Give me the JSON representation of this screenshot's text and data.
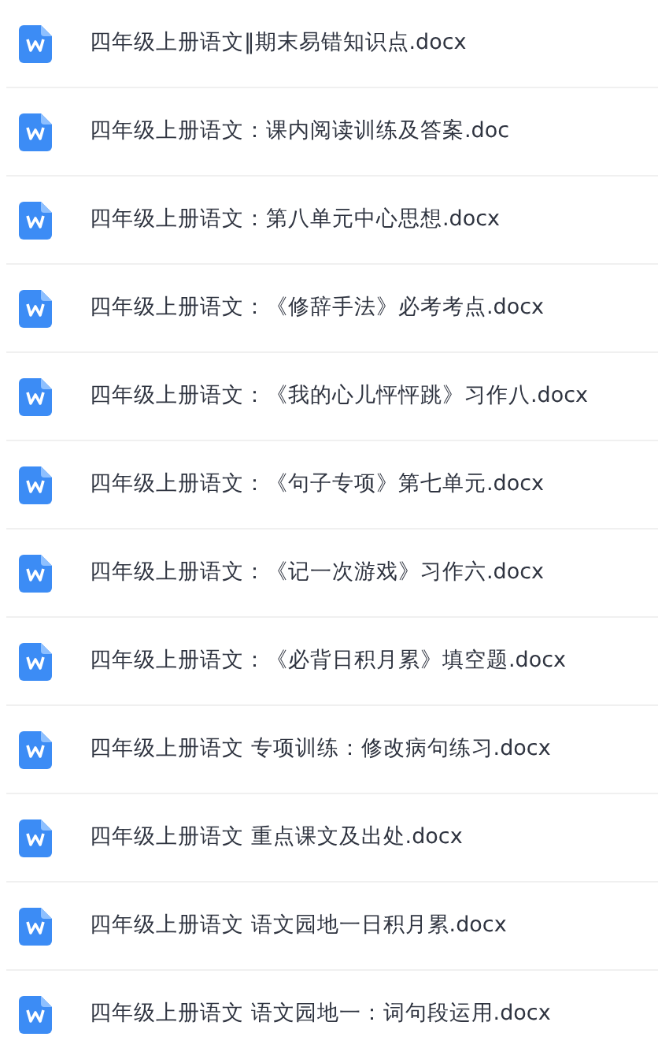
{
  "files": [
    {
      "name": "四年级上册语文‖期末易错知识点.docx"
    },
    {
      "name": "四年级上册语文：课内阅读训练及答案.doc"
    },
    {
      "name": "四年级上册语文：第八单元中心思想.docx"
    },
    {
      "name": "四年级上册语文：《修辞手法》必考考点.docx"
    },
    {
      "name": "四年级上册语文：《我的心儿怦怦跳》习作八.docx"
    },
    {
      "name": "四年级上册语文：《句子专项》第七单元.docx"
    },
    {
      "name": "四年级上册语文：《记一次游戏》习作六.docx"
    },
    {
      "name": "四年级上册语文：《必背日积月累》填空题.docx"
    },
    {
      "name": "四年级上册语文 专项训练：修改病句练习.docx"
    },
    {
      "name": "四年级上册语文 重点课文及出处.docx"
    },
    {
      "name": "四年级上册语文 语文园地一日积月累.docx"
    },
    {
      "name": "四年级上册语文 语文园地一：词句段运用.docx"
    }
  ]
}
